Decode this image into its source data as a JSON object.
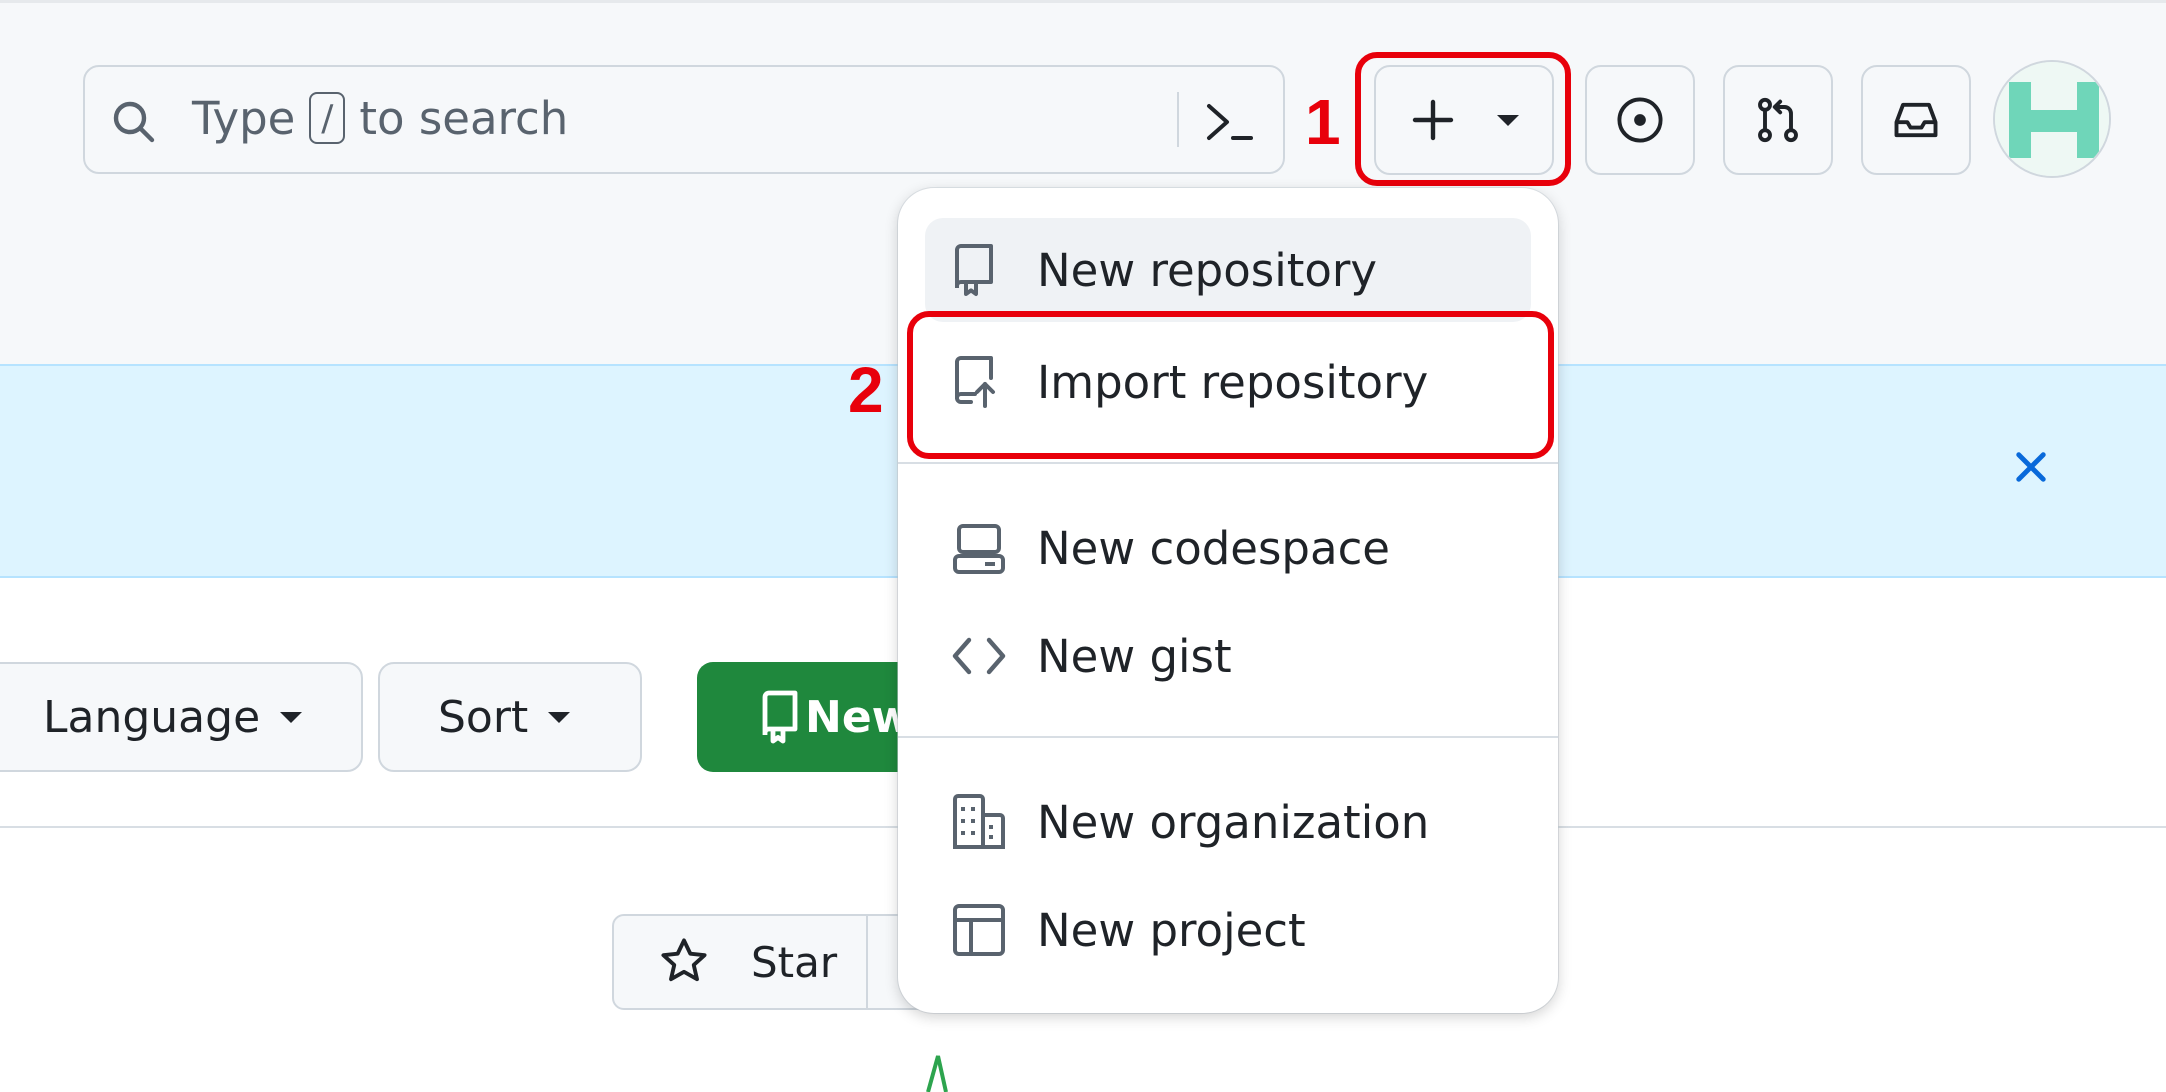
{
  "search": {
    "placeholder_before": "Type",
    "shortcut_key": "/",
    "placeholder_after": "to search"
  },
  "annotations": {
    "step1": "1",
    "step2": "2",
    "color": "#e8000b"
  },
  "create_menu": {
    "items": [
      {
        "label": "New repository",
        "icon": "repo-icon"
      },
      {
        "label": "Import repository",
        "icon": "repo-push-icon"
      },
      {
        "label": "New codespace",
        "icon": "codespaces-icon"
      },
      {
        "label": "New gist",
        "icon": "code-icon"
      },
      {
        "label": "New organization",
        "icon": "organization-icon"
      },
      {
        "label": "New project",
        "icon": "table-icon"
      }
    ]
  },
  "filters": {
    "language_label": "Language",
    "sort_label": "Sort"
  },
  "new_button": {
    "label_visible": "New"
  },
  "star_button": {
    "label": "Star"
  },
  "colors": {
    "accent_green": "#1f883d",
    "banner_bg": "#ddf4ff",
    "close_blue": "#0969da"
  }
}
